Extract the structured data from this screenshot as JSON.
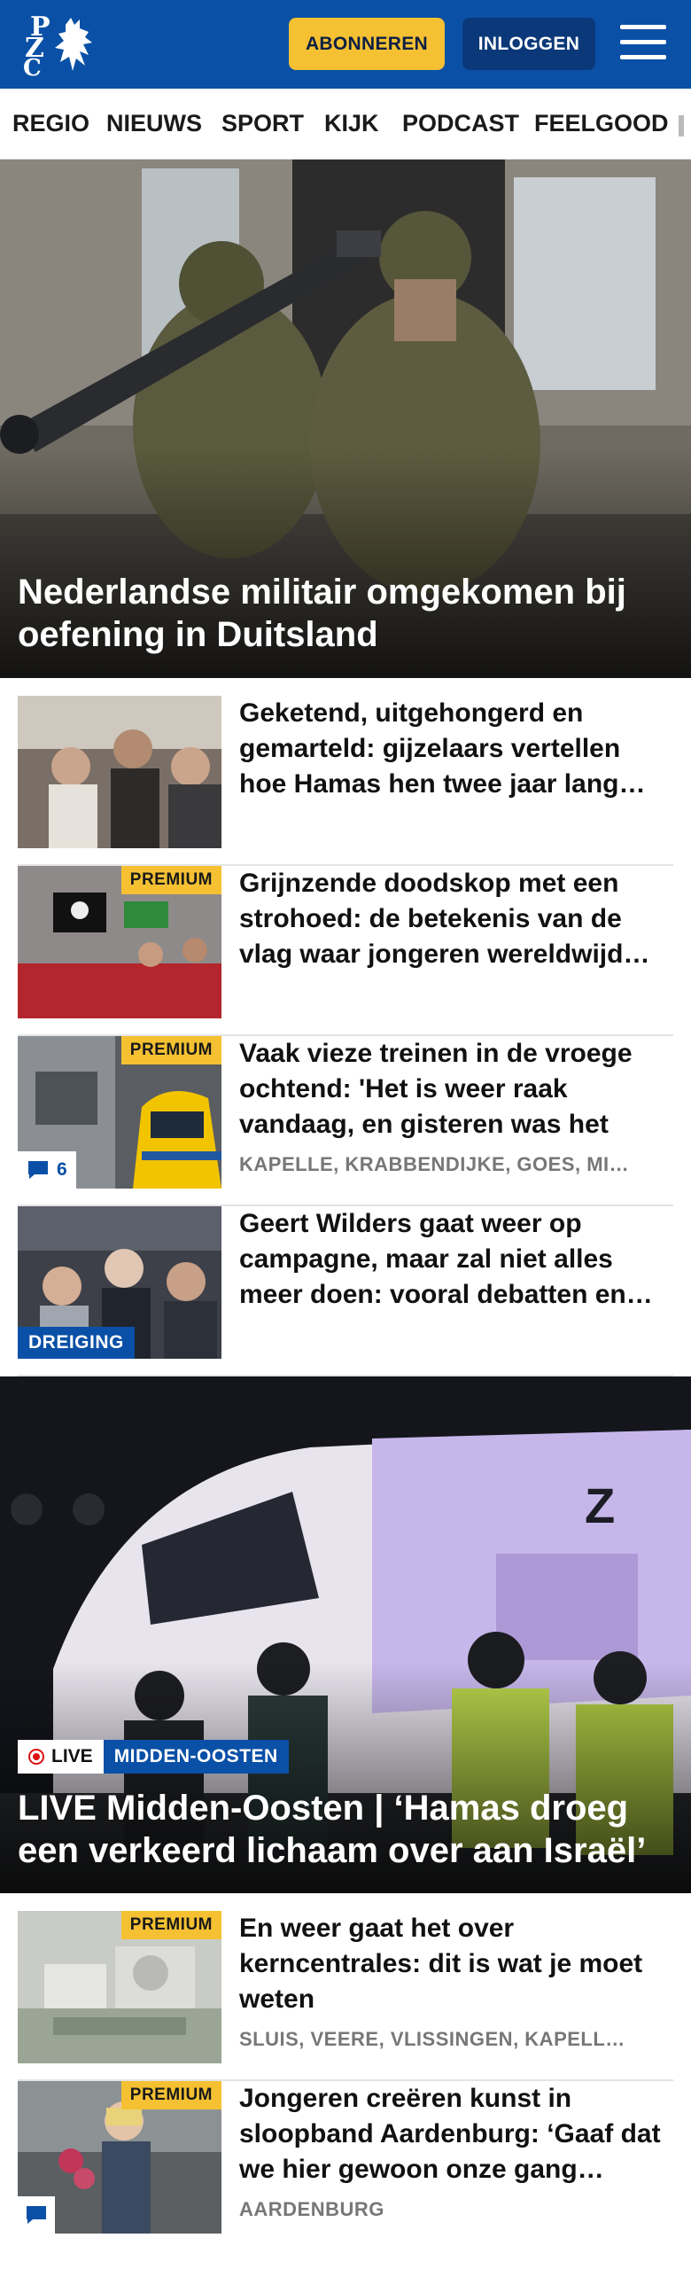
{
  "header": {
    "logo_text": [
      "P",
      "Z",
      "C"
    ],
    "subscribe_label": "ABONNEREN",
    "login_label": "INLOGGEN",
    "brand_color": "#0a50a6",
    "accent_color": "#f5c132"
  },
  "nav": {
    "items": [
      "REGIO",
      "NIEUWS",
      "SPORT",
      "KIJK",
      "PODCAST",
      "FEELGOOD"
    ]
  },
  "hero1": {
    "title": "Nederlandse militair omgekomen bij oefening in Duitsland"
  },
  "articles1": [
    {
      "title": "Geketend, uitgehongerd en gemarteld: gijzelaars vertellen hoe Hamas hen twee jaar lang…",
      "premium": ""
    },
    {
      "title": "Grijnzende doodskop met een strohoed: de betekenis van de vlag waar jongeren wereldwijd…",
      "premium": "PREMIUM"
    },
    {
      "title": "Vaak vieze treinen in de vroege ochtend: 'Het is weer raak vandaag, en gisteren was het oo…",
      "premium": "PREMIUM",
      "location": "KAPELLE, KRABBENDIJKE, GOES, MI…",
      "comments": "6"
    },
    {
      "title": "Geert Wilders gaat weer op campagne, maar zal niet alles meer doen: vooral debatten en…",
      "tag": "DREIGING"
    }
  ],
  "hero2": {
    "live_label": "LIVE",
    "category": "MIDDEN-OOSTEN",
    "title": "LIVE Midden-Oosten | ‘Hamas droeg een verkeerd lichaam over aan Israël’"
  },
  "articles2": [
    {
      "title": "En weer gaat het over kerncentrales: dit is wat je moet weten",
      "premium": "PREMIUM",
      "location": "SLUIS, VEERE, VLISSINGEN, KAPELL…"
    },
    {
      "title": "Jongeren creëren kunst in sloopband Aardenburg: ‘Gaaf dat we hier gewoon onze gang…",
      "premium": "PREMIUM",
      "location": "AARDENBURG"
    }
  ]
}
